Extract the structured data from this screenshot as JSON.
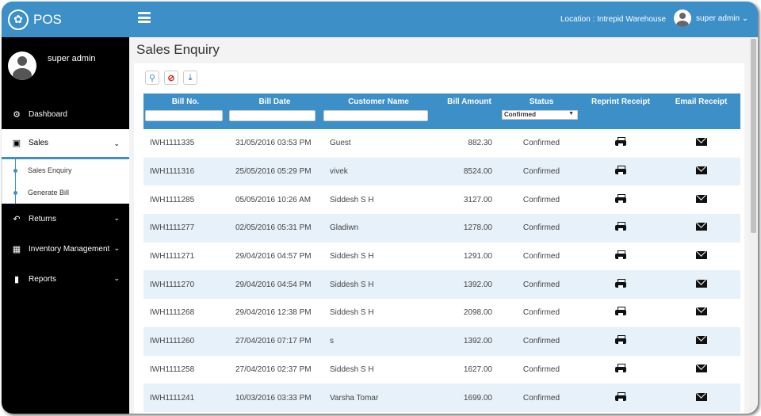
{
  "app": {
    "brand": "POS",
    "brand_icon": "paw-icon"
  },
  "header": {
    "location": "Location : Intrepid Warehouse",
    "user": "super admin ⌄"
  },
  "sidebar": {
    "profile_name": "super admin",
    "items": [
      {
        "label": "Dashboard",
        "icon": "tachometer-icon"
      },
      {
        "label": "Sales",
        "icon": "money-icon",
        "active": true
      },
      {
        "label": "Returns",
        "icon": "reply-icon"
      },
      {
        "label": "Inventory Management",
        "icon": "cubes-icon"
      },
      {
        "label": "Reports",
        "icon": "bar-chart-icon"
      }
    ],
    "sales_sub": [
      "Sales Enquiry",
      "Generate Bill"
    ]
  },
  "page": {
    "title": "Sales Enquiry"
  },
  "table": {
    "headers": [
      "Bill No.",
      "Bill Date",
      "Customer Name",
      "Bill Amount",
      "Status",
      "Reprint Receipt",
      "Email Receipt"
    ],
    "status_filter": "Confirmed",
    "rows": [
      {
        "bill_no": "IWH1111335",
        "date": "31/05/2016 03:53 PM",
        "customer": "Guest",
        "amount": "882.30",
        "status": "Confirmed"
      },
      {
        "bill_no": "IWH1111316",
        "date": "25/05/2016 05:29 PM",
        "customer": "vivek",
        "amount": "8524.00",
        "status": "Confirmed"
      },
      {
        "bill_no": "IWH1111285",
        "date": "05/05/2016 10:26 AM",
        "customer": "Siddesh S H",
        "amount": "3127.00",
        "status": "Confirmed"
      },
      {
        "bill_no": "IWH1111277",
        "date": "02/05/2016 05:31 PM",
        "customer": "Gladiwn",
        "amount": "1278.00",
        "status": "Confirmed"
      },
      {
        "bill_no": "IWH1111271",
        "date": "29/04/2016 04:57 PM",
        "customer": "Siddesh S H",
        "amount": "1291.00",
        "status": "Confirmed"
      },
      {
        "bill_no": "IWH1111270",
        "date": "29/04/2016 04:54 PM",
        "customer": "Siddesh S H",
        "amount": "1392.00",
        "status": "Confirmed"
      },
      {
        "bill_no": "IWH1111268",
        "date": "29/04/2016 12:38 PM",
        "customer": "Siddesh S H",
        "amount": "2098.00",
        "status": "Confirmed"
      },
      {
        "bill_no": "IWH1111260",
        "date": "27/04/2016 07:17 PM",
        "customer": "s",
        "amount": "1392.00",
        "status": "Confirmed"
      },
      {
        "bill_no": "IWH1111258",
        "date": "27/04/2016 02:37 PM",
        "customer": "Siddesh S H",
        "amount": "1627.00",
        "status": "Confirmed"
      },
      {
        "bill_no": "IWH1111241",
        "date": "10/03/2016 03:33 PM",
        "customer": "Varsha Tomar",
        "amount": "1699.00",
        "status": "Confirmed"
      }
    ]
  },
  "colors": {
    "primary": "#3d8fc8",
    "sidebar_bg": "#000000",
    "row_alt": "#e6f1fa"
  }
}
